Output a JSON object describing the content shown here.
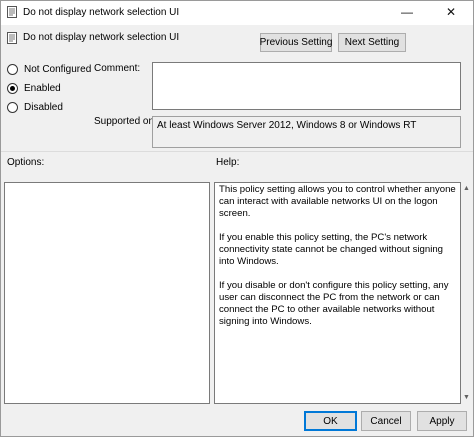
{
  "window": {
    "title": "Do not display network selection UI",
    "icon": "policy-setting-icon",
    "minimize_glyph": "—",
    "close_glyph": "✕"
  },
  "header": {
    "setting_name": "Do not display network selection UI",
    "previous_setting": "Previous Setting",
    "next_setting": "Next Setting"
  },
  "state": {
    "options": [
      {
        "label": "Not Configured",
        "checked": false
      },
      {
        "label": "Enabled",
        "checked": true
      },
      {
        "label": "Disabled",
        "checked": false
      }
    ]
  },
  "comment": {
    "label": "Comment:",
    "value": ""
  },
  "supported": {
    "label": "Supported on:",
    "value": "At least Windows Server 2012, Windows 8 or Windows RT"
  },
  "options_panel": {
    "label": "Options:"
  },
  "help_panel": {
    "label": "Help:",
    "paragraphs": [
      "This policy setting allows you to control whether anyone can interact with available networks UI on the logon screen.",
      "If you enable this policy setting, the PC's network connectivity state cannot be changed without signing into Windows.",
      "If you disable or don't configure this policy setting, any user can disconnect the PC from the network or can connect the PC to other available networks without signing into Windows."
    ]
  },
  "footer": {
    "ok": "OK",
    "cancel": "Cancel",
    "apply": "Apply"
  }
}
